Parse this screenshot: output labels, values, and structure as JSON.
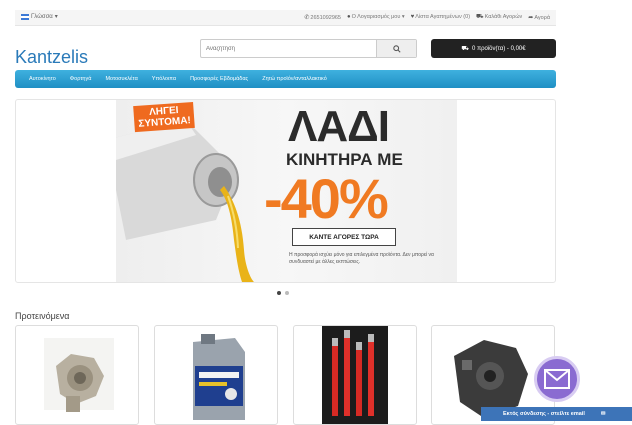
{
  "topbar": {
    "language": "Γλώσσα",
    "phone": "2651092965",
    "account": "Ο Λογαριασμός μου",
    "wishlist": "Λίστα Αγαπημένων (0)",
    "cart_link": "Καλάθι Αγορών",
    "checkout": "Αγορά"
  },
  "header": {
    "logo": "Kantzelis",
    "search_placeholder": "Αναζήτηση",
    "cart_summary": "0 προϊόν(τα) - 0,00€"
  },
  "nav": {
    "items": [
      "Αυτοκίνητο",
      "Φορτηγά",
      "Μοτοσυκλέτα",
      "Υπόλοιπα",
      "Προσφορές Εβδομάδας",
      "Ζητώ προϊόν/ανταλλακτικό"
    ]
  },
  "banner": {
    "ribbon_line1": "ΛΗΓΕΙ",
    "ribbon_line2": "ΣΥΝΤΟΜΑ!",
    "headline1": "ΛΑΔΙ",
    "headline2": "ΚΙΝΗΤΗΡΑ ΜΕ",
    "discount": "-40%",
    "cta": "ΚΑΝΤΕ ΑΓΟΡΕΣ ΤΩΡΑ",
    "disclaimer": "Η προσφορά ισχύει μόνο για επιλεγμένα προϊόντα. Δεν μπορεί να συνδυαστεί με άλλες εκπτώσεις."
  },
  "featured": {
    "title": "Προτεινόμενα"
  },
  "chat": {
    "label": "Εκτός σύνδεσης - στείλτε email"
  },
  "colors": {
    "nav": "#1f8fc4",
    "logo": "#2a7ab9",
    "discount": "#f07a22",
    "ribbon": "#ef6a1f",
    "chat_bar": "#3d74b8",
    "chat_icon": "#8a6bd1"
  }
}
